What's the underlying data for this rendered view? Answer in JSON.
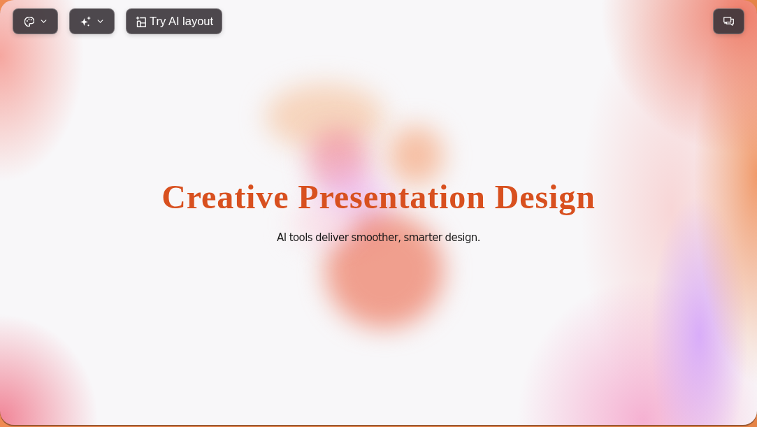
{
  "toolbar": {
    "buttons": [
      {
        "kind": "palette",
        "dropdown": true
      },
      {
        "kind": "sparkle",
        "dropdown": true
      },
      {
        "kind": "layout",
        "dropdown": false,
        "label": "Try AI layout"
      }
    ],
    "side_button": {
      "kind": "chat"
    }
  },
  "slide": {
    "title": "Creative Presentation Design",
    "subtitle": "AI tools deliver smoother, smarter design."
  }
}
